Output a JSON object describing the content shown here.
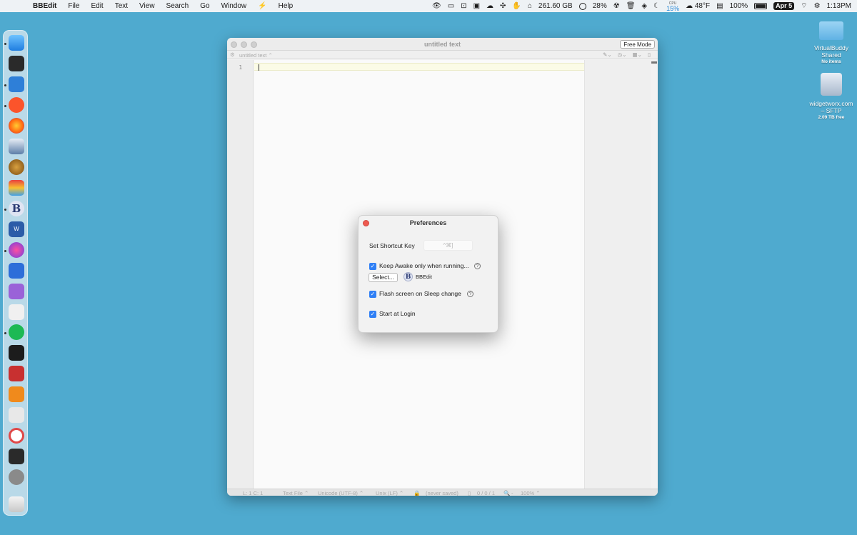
{
  "menubar": {
    "app_name": "BBEdit",
    "menus": [
      "File",
      "Edit",
      "Text",
      "View",
      "Search",
      "Go",
      "Window",
      "Help"
    ],
    "disk_free": "261.60 GB",
    "progress_pct": "28%",
    "cpu_label": "CPU",
    "cpu_value": "15%",
    "weather": "48°F",
    "battery_pct": "100%",
    "date": "Apr 5",
    "time": "1:13PM"
  },
  "desktop": {
    "items": [
      {
        "label": "VirtualBuddy Shared",
        "sub": "No items"
      },
      {
        "label": "widgetworx.com – SFTP",
        "sub": "2.09 TB free"
      }
    ]
  },
  "bbedit": {
    "title": "untitled text",
    "free_mode": "Free Mode",
    "doc_menu": "untitled text ⌃",
    "line_number": "1",
    "status": {
      "position": "L: 1 C: 1",
      "file_type": "Text File ⌃",
      "encoding": "Unicode (UTF-8) ⌃",
      "line_endings": "Unix (LF) ⌃",
      "saved": "(never saved)",
      "counts": "0 / 0 / 1",
      "zoom_prefix": "-",
      "zoom": "100% ⌃"
    }
  },
  "prefs": {
    "title": "Preferences",
    "shortcut_label": "Set Shortcut Key",
    "shortcut_value": "^⌘]",
    "keep_awake_label": "Keep Awake only when running...",
    "select_button": "Select...",
    "selected_app": "BBEdit",
    "flash_label": "Flash screen on Sleep change",
    "login_label": "Start at Login",
    "help_glyph": "?",
    "checkbox_checked": {
      "keep_awake": true,
      "flash": true,
      "login": true
    }
  },
  "colors": {
    "desktop": "#4faacf",
    "accent": "#2f7ff5",
    "close": "#ee5a50"
  }
}
